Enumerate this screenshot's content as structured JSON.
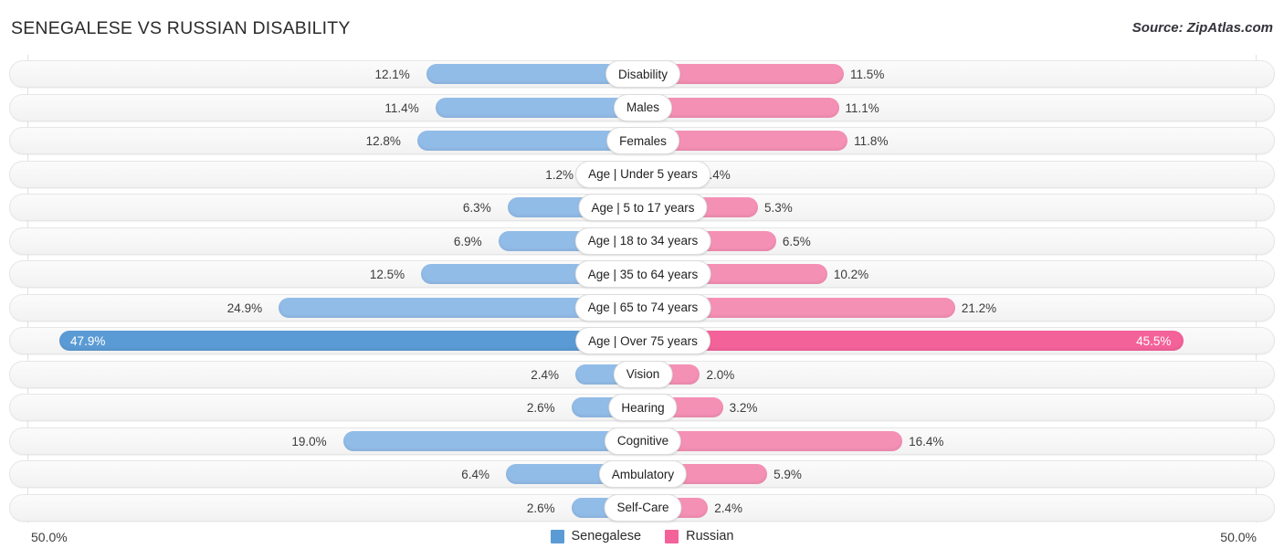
{
  "header": {
    "title": "SENEGALESE VS RUSSIAN DISABILITY",
    "source": "Source: ZipAtlas.com"
  },
  "colors": {
    "left_light": "#92bce8",
    "right_light": "#f590b5",
    "left_strong": "#5b9bd5",
    "right_strong": "#f4629a",
    "track": "#f7f7f7",
    "track_border": "#e6e6e6",
    "gridline": "#e2e2e2",
    "text": "#3c3c3c"
  },
  "axis": {
    "left_end": "50.0%",
    "right_end": "50.0%",
    "max": 50.0
  },
  "legend": [
    {
      "label": "Senegalese",
      "color": "#5b9bd5",
      "swatch_name": "legend-swatch-senegalese"
    },
    {
      "label": "Russian",
      "color": "#f4629a",
      "swatch_name": "legend-swatch-russian"
    }
  ],
  "chart_data": {
    "type": "bar",
    "title": "SENEGALESE VS RUSSIAN DISABILITY",
    "subtitle": "Source: ZipAtlas.com",
    "orientation": "horizontal-diverging",
    "xlabel": "",
    "ylabel": "",
    "xlim": [
      -50.0,
      50.0
    ],
    "axis_end_labels": [
      "50.0%",
      "50.0%"
    ],
    "grid": true,
    "legend_position": "bottom-center",
    "categories": [
      "Disability",
      "Males",
      "Females",
      "Age | Under 5 years",
      "Age | 5 to 17 years",
      "Age | 18 to 34 years",
      "Age | 35 to 64 years",
      "Age | 65 to 74 years",
      "Age | Over 75 years",
      "Vision",
      "Hearing",
      "Cognitive",
      "Ambulatory",
      "Self-Care"
    ],
    "series": [
      {
        "name": "Senegalese",
        "color": "#5b9bd5",
        "side": "left",
        "values": [
          12.1,
          11.4,
          12.8,
          1.2,
          6.3,
          6.9,
          12.5,
          24.9,
          47.9,
          2.4,
          2.6,
          19.0,
          6.4,
          2.6
        ],
        "labels": [
          "12.1%",
          "11.4%",
          "12.8%",
          "1.2%",
          "6.3%",
          "6.9%",
          "12.5%",
          "24.9%",
          "47.9%",
          "2.4%",
          "2.6%",
          "19.0%",
          "6.4%",
          "2.6%"
        ]
      },
      {
        "name": "Russian",
        "color": "#f4629a",
        "side": "right",
        "values": [
          11.5,
          11.1,
          11.8,
          1.4,
          5.3,
          6.5,
          10.2,
          21.2,
          45.5,
          2.0,
          3.2,
          16.4,
          5.9,
          2.4
        ],
        "labels": [
          "11.5%",
          "11.1%",
          "11.8%",
          "1.4%",
          "5.3%",
          "6.5%",
          "10.2%",
          "21.2%",
          "45.5%",
          "2.0%",
          "3.2%",
          "16.4%",
          "5.9%",
          "2.4%"
        ]
      }
    ],
    "highlighted_row": "Age | Over 75 years"
  }
}
